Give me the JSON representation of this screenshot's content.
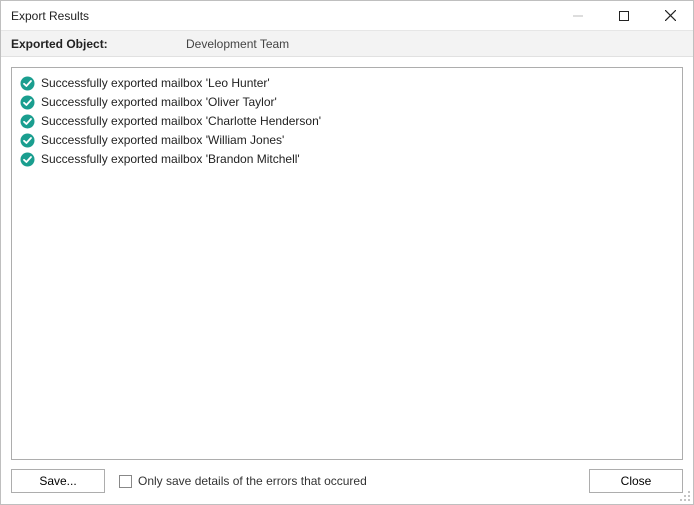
{
  "window": {
    "title": "Export Results"
  },
  "header": {
    "label": "Exported Object:",
    "value": "Development Team"
  },
  "results": [
    {
      "status": "success",
      "text": "Successfully exported mailbox 'Leo Hunter'"
    },
    {
      "status": "success",
      "text": "Successfully exported mailbox 'Oliver Taylor'"
    },
    {
      "status": "success",
      "text": "Successfully exported mailbox 'Charlotte Henderson'"
    },
    {
      "status": "success",
      "text": "Successfully exported mailbox 'William Jones'"
    },
    {
      "status": "success",
      "text": "Successfully exported mailbox 'Brandon Mitchell'"
    }
  ],
  "footer": {
    "save_label": "Save...",
    "checkbox_label": "Only save details of the errors that occured",
    "checkbox_checked": false,
    "close_label": "Close"
  },
  "icons": {
    "success_color": "#1a9e8f"
  }
}
